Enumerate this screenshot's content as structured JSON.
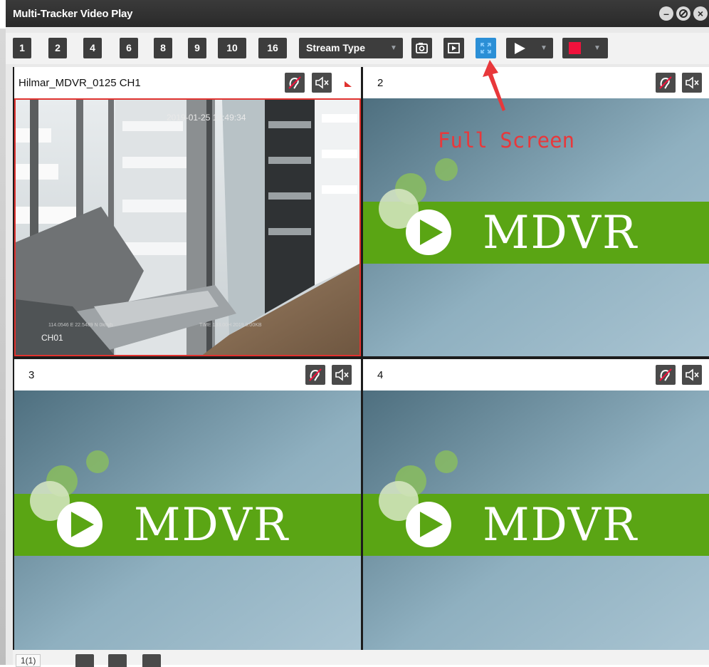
{
  "window": {
    "title": "Multi-Tracker Video Play"
  },
  "toolbar": {
    "layout_buttons": [
      "1",
      "2",
      "4",
      "6",
      "8",
      "9",
      "10",
      "16"
    ],
    "stream_type_label": "Stream Type"
  },
  "cells": [
    {
      "title": "Hilmar_MDVR_0125  CH1",
      "active": true
    },
    {
      "title": "2",
      "active": false
    },
    {
      "title": "3",
      "active": false
    },
    {
      "title": "4",
      "active": false
    }
  ],
  "live_feed": {
    "timestamp": "2019-01-25 14:49:34",
    "channel_osd": "CH01",
    "status_osd_left": "114.0546 E 22.5489 N 0km/h",
    "status_osd_right": "TIME 133.00H 2019.0.00KB"
  },
  "placeholder": {
    "logo_text": "MDVR"
  },
  "annotation": {
    "text": "Full Screen",
    "color": "#e8383b"
  },
  "pager": {
    "page_label": "1(1)"
  },
  "colors": {
    "titlebar": "#2e2e2e",
    "button": "#3d3d3d",
    "fullscreen_button": "#2b8fd6",
    "record_red": "#f0123c",
    "placeholder_green": "#5aa514",
    "active_border": "#e0322f"
  }
}
